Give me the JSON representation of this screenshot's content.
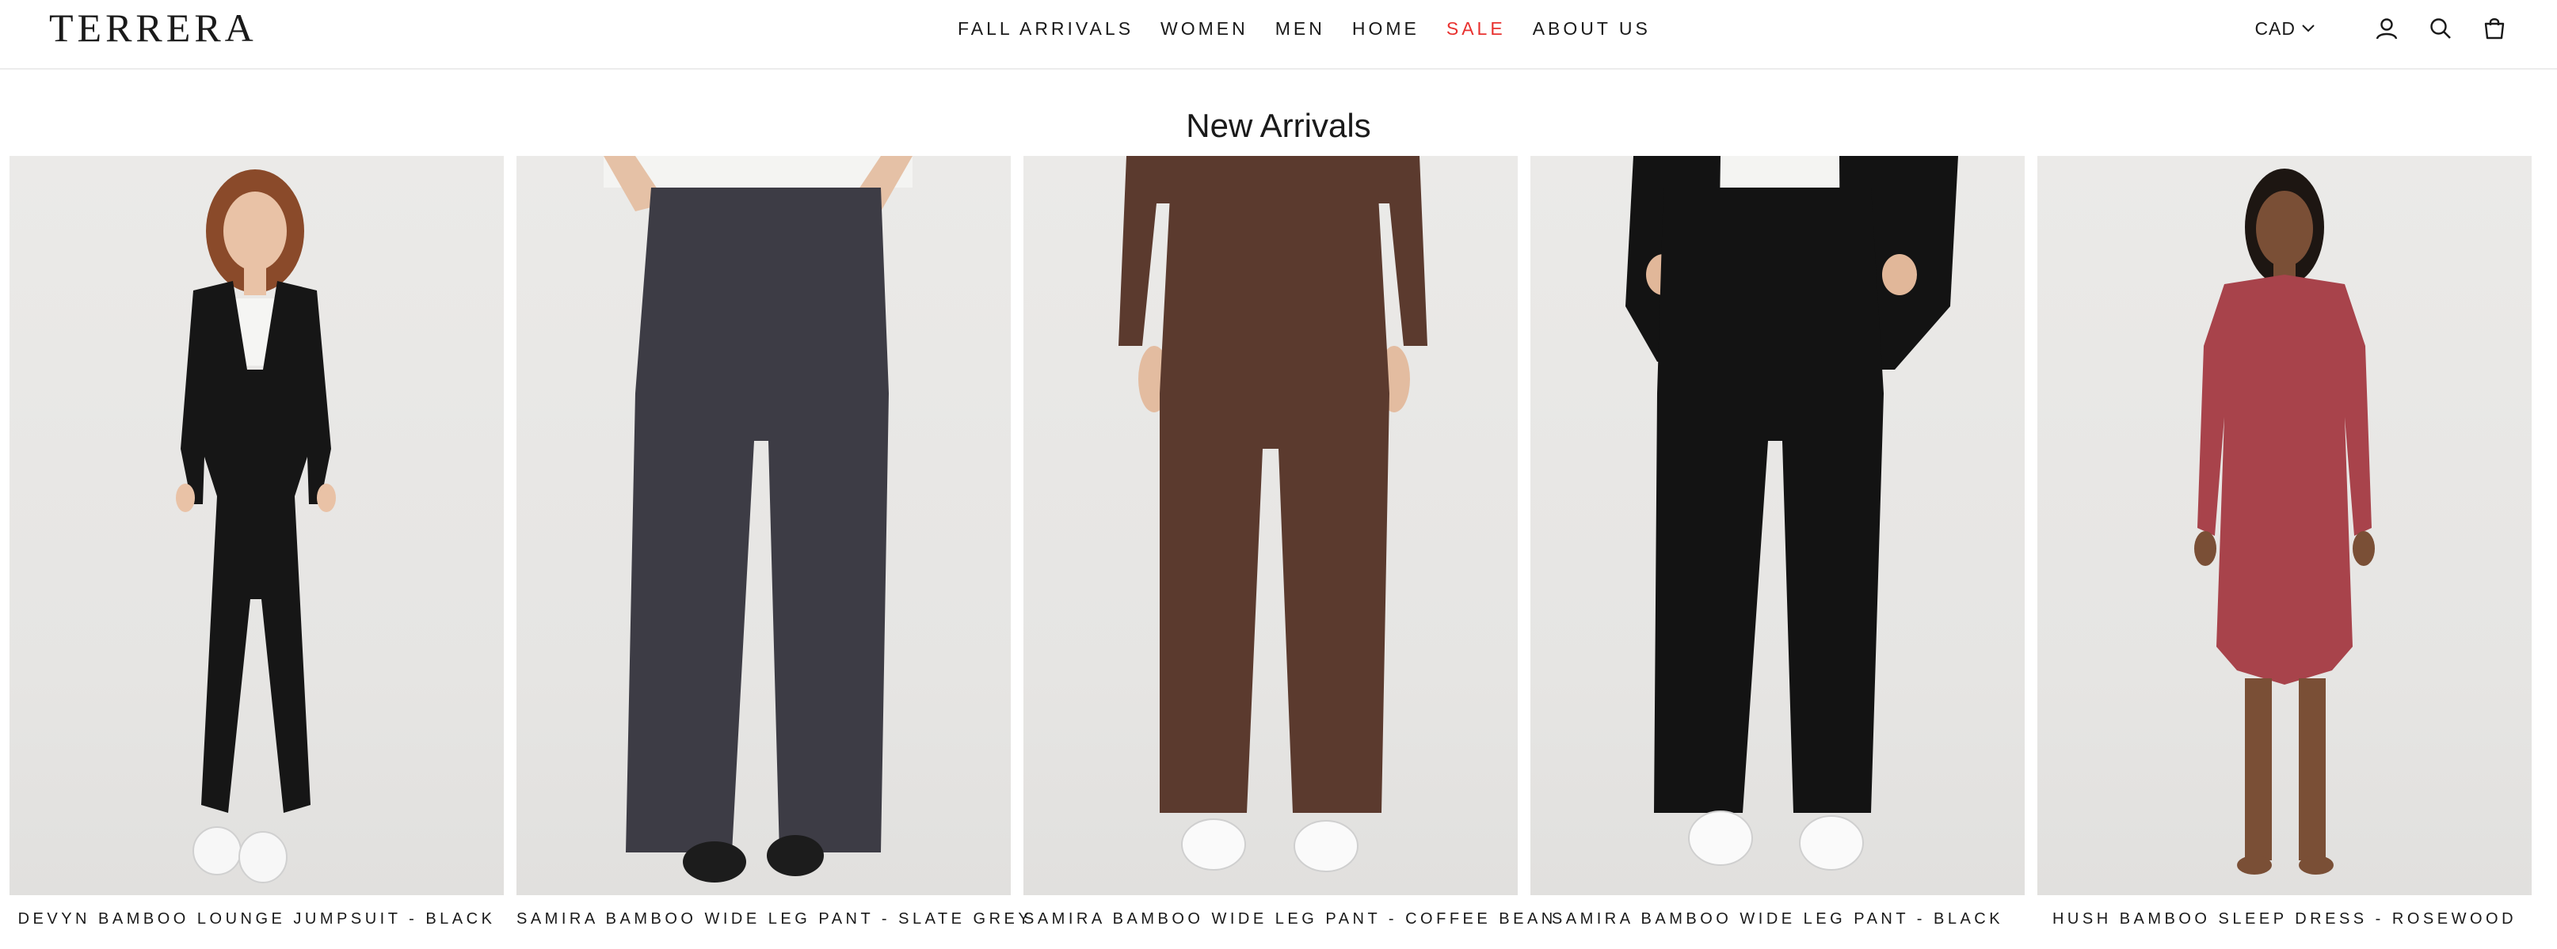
{
  "brand": {
    "logo_text": "TERRERA"
  },
  "nav": {
    "items": [
      {
        "label": "FALL ARRIVALS",
        "key": "fall-arrivals"
      },
      {
        "label": "WOMEN",
        "key": "women"
      },
      {
        "label": "MEN",
        "key": "men"
      },
      {
        "label": "HOME",
        "key": "home"
      },
      {
        "label": "SALE",
        "key": "sale",
        "color": "#e8312f"
      },
      {
        "label": "ABOUT US",
        "key": "about-us"
      }
    ]
  },
  "utility": {
    "currency": "CAD",
    "icons": [
      "chevron-down-icon",
      "account-icon",
      "search-icon",
      "cart-icon"
    ]
  },
  "collection": {
    "title": "New Arrivals"
  },
  "products": [
    {
      "title": "DEVYN BAMBOO LOUNGE JUMPSUIT - BLACK",
      "garment_color": "#161616"
    },
    {
      "title": "SAMIRA BAMBOO WIDE LEG PANT - SLATE GREY",
      "garment_color": "#3d3c45"
    },
    {
      "title": "SAMIRA BAMBOO WIDE LEG PANT - COFFEE BEAN",
      "garment_color": "#5b3a2e"
    },
    {
      "title": "SAMIRA BAMBOO WIDE LEG PANT - BLACK",
      "garment_color": "#131313"
    },
    {
      "title": "HUSH BAMBOO SLEEP DRESS - ROSEWOOD",
      "garment_color": "#a8434b"
    }
  ],
  "colors": {
    "text": "#1a1a1a",
    "sale": "#e8312f",
    "photo_background": "#e8e7e5",
    "divider": "#ececec"
  }
}
